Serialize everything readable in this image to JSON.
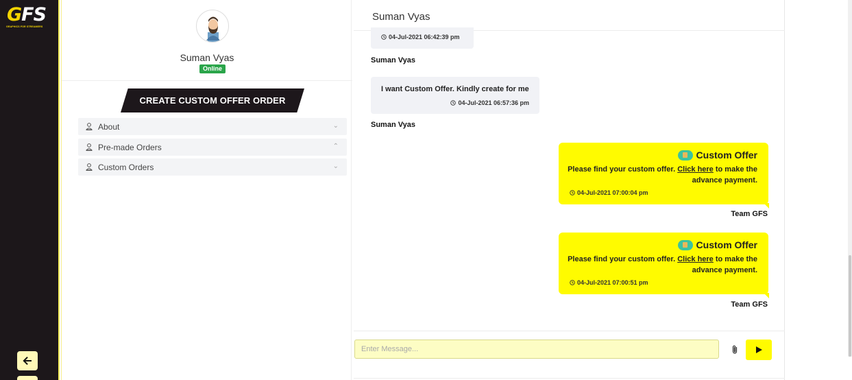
{
  "brand": {
    "logo_text": "GFS",
    "logo_sub": "GRAPHICS FOR STREAMERS"
  },
  "rail": {
    "back_icon": "arrow-left-icon",
    "second_icon": "unknown-icon"
  },
  "profile": {
    "name": "Suman Vyas",
    "status": "Online",
    "status_color": "#2aa54a",
    "offer_button": "CREATE CUSTOM OFFER ORDER",
    "accordion": [
      {
        "label": "About",
        "chevron": "⌄",
        "icon": "user-icon"
      },
      {
        "label": "Pre-made Orders",
        "chevron": "⌃",
        "icon": "user-icon"
      },
      {
        "label": "Custom Orders",
        "chevron": "⌄",
        "icon": "user-icon"
      }
    ]
  },
  "chat": {
    "title": "Suman Vyas",
    "messages_in": [
      {
        "text": "",
        "timestamp": "04-Jul-2021 06:42:39 pm",
        "sender": "Suman Vyas"
      },
      {
        "text": "I want Custom Offer. Kindly create for me",
        "timestamp": "04-Jul-2021 06:57:36 pm",
        "sender": "Suman Vyas"
      }
    ],
    "messages_out": [
      {
        "title": "Custom Offer",
        "text_before": "Please find your custom offer. ",
        "link": "Click here",
        "text_after": " to make the advance payment.",
        "timestamp": "04-Jul-2021 07:00:04 pm",
        "sender": "Team GFS"
      },
      {
        "title": "Custom Offer",
        "text_before": "Please find your custom offer. ",
        "link": "Click here",
        "text_after": " to make the advance payment.",
        "timestamp": "04-Jul-2021 07:00:51 pm",
        "sender": "Team GFS"
      }
    ],
    "input_placeholder": "Enter Message...",
    "accent_color": "#fffb00"
  }
}
